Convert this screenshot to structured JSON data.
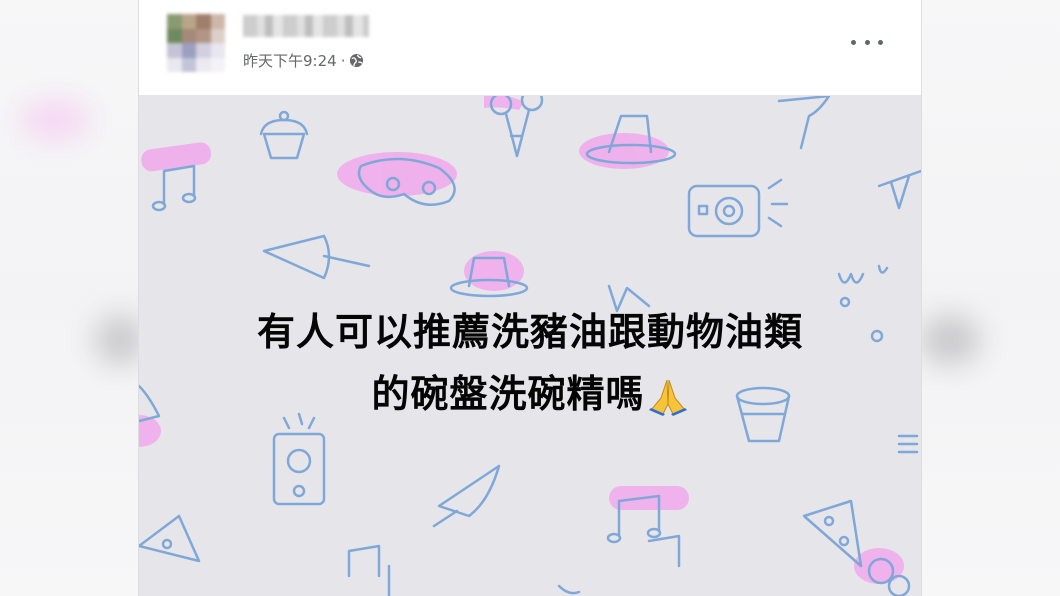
{
  "post": {
    "timestamp": "昨天下午9:24",
    "separator": "·",
    "privacy_icon": "globe-icon",
    "more_icon": "more-options-icon",
    "text_line1": "有人可以推薦洗豬油跟動物油類",
    "text_line2": "的碗盤洗碗精嗎",
    "emoji": "folded-hands-icon"
  },
  "colors": {
    "background_panel": "#e6e6ea",
    "doodle_stroke": "#7fa7d8",
    "doodle_highlight": "#f0a8ec",
    "meta_text": "#65676b"
  }
}
